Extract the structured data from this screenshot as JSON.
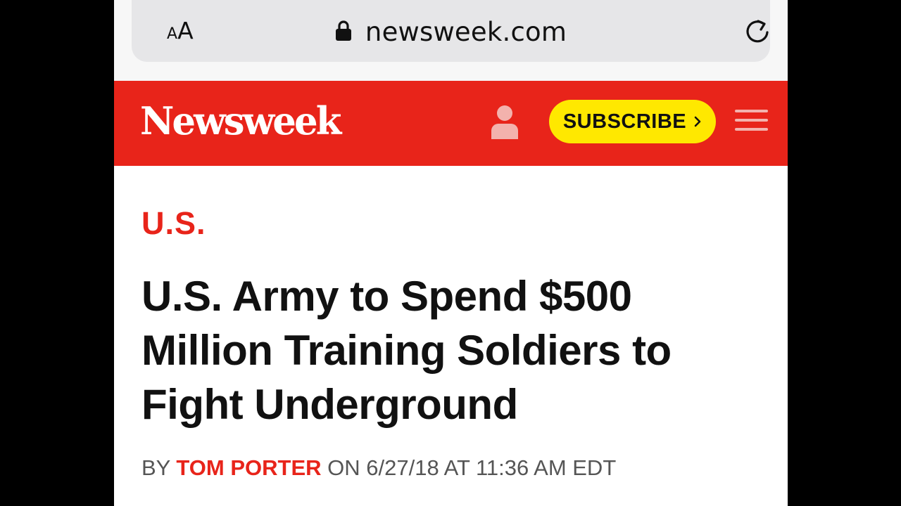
{
  "browser": {
    "text_size_small": "A",
    "text_size_large": "A",
    "url": "newsweek.com"
  },
  "header": {
    "logo": "Newsweek",
    "subscribe_label": "SUBSCRIBE",
    "colors": {
      "brand_red": "#e8241a",
      "subscribe_yellow": "#ffe800"
    }
  },
  "article": {
    "section": "U.S.",
    "headline": "U.S. Army to Spend $500 Million Training Soldiers to Fight Underground",
    "byline": {
      "prefix": "BY",
      "author": "TOM PORTER",
      "date_text": "ON 6/27/18 AT 11:36 AM EDT"
    }
  },
  "icons": [
    "lock-icon",
    "reload-icon",
    "user-icon",
    "chevron-right-icon",
    "hamburger-menu-icon"
  ]
}
